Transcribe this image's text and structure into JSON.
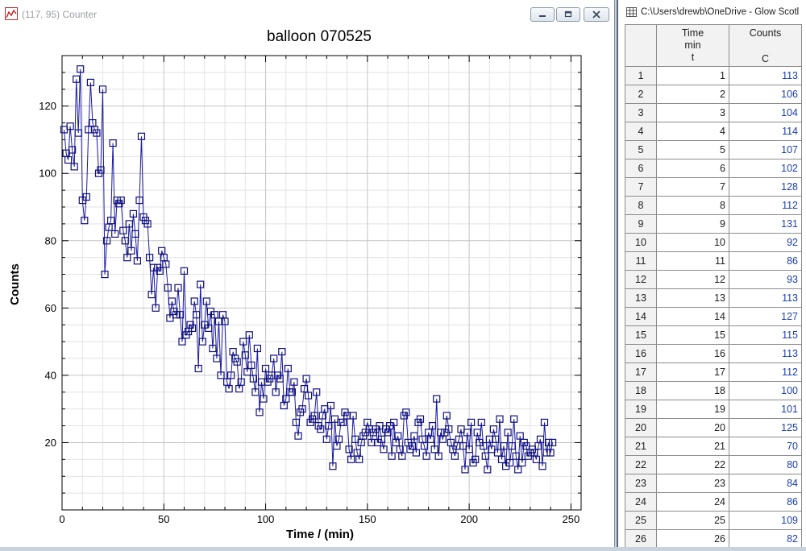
{
  "graph_window": {
    "title": "(117, 95) Counter",
    "buttons": {
      "minimize": "minimize-icon",
      "restore": "restore-icon",
      "close": "close-icon"
    }
  },
  "table_window": {
    "title": "C:\\Users\\drewb\\OneDrive - Glow Scotl",
    "columns": [
      {
        "line1": "Time",
        "line2": "min",
        "line3": "t"
      },
      {
        "line1": "Counts",
        "line2": "",
        "line3": "C"
      }
    ],
    "rows": [
      {
        "n": "1",
        "t": "1",
        "c": "113"
      },
      {
        "n": "2",
        "t": "2",
        "c": "106"
      },
      {
        "n": "3",
        "t": "3",
        "c": "104"
      },
      {
        "n": "4",
        "t": "4",
        "c": "114"
      },
      {
        "n": "5",
        "t": "5",
        "c": "107"
      },
      {
        "n": "6",
        "t": "6",
        "c": "102"
      },
      {
        "n": "7",
        "t": "7",
        "c": "128"
      },
      {
        "n": "8",
        "t": "8",
        "c": "112"
      },
      {
        "n": "9",
        "t": "9",
        "c": "131"
      },
      {
        "n": "10",
        "t": "10",
        "c": "92"
      },
      {
        "n": "11",
        "t": "11",
        "c": "86"
      },
      {
        "n": "12",
        "t": "12",
        "c": "93"
      },
      {
        "n": "13",
        "t": "13",
        "c": "113"
      },
      {
        "n": "14",
        "t": "14",
        "c": "127"
      },
      {
        "n": "15",
        "t": "15",
        "c": "115"
      },
      {
        "n": "16",
        "t": "16",
        "c": "113"
      },
      {
        "n": "17",
        "t": "17",
        "c": "112"
      },
      {
        "n": "18",
        "t": "18",
        "c": "100"
      },
      {
        "n": "19",
        "t": "19",
        "c": "101"
      },
      {
        "n": "20",
        "t": "20",
        "c": "125"
      },
      {
        "n": "21",
        "t": "21",
        "c": "70"
      },
      {
        "n": "22",
        "t": "22",
        "c": "80"
      },
      {
        "n": "23",
        "t": "23",
        "c": "84"
      },
      {
        "n": "24",
        "t": "24",
        "c": "86"
      },
      {
        "n": "25",
        "t": "25",
        "c": "109"
      },
      {
        "n": "26",
        "t": "26",
        "c": "82"
      }
    ]
  },
  "chart_data": {
    "type": "line",
    "title": "balloon 070525",
    "xlabel": "Time / (min)",
    "ylabel": "Counts",
    "xlim": [
      0,
      255
    ],
    "ylim": [
      0,
      135
    ],
    "xticks": [
      0,
      50,
      100,
      150,
      200,
      250
    ],
    "yticks": [
      20,
      40,
      60,
      80,
      100,
      120
    ],
    "grid": true,
    "marker": "square",
    "line_color": "#1a1aa0",
    "series": [
      {
        "x": [
          1,
          2,
          3,
          4,
          5,
          6,
          7,
          8,
          9,
          10,
          11,
          12,
          13,
          14,
          15,
          16,
          17,
          18,
          19,
          20,
          21,
          22,
          23,
          24,
          25,
          26,
          27,
          28,
          29,
          30,
          31,
          32,
          33,
          34,
          35,
          36,
          37,
          38,
          39,
          40,
          41,
          42,
          43,
          44,
          45,
          46,
          47,
          48,
          49,
          50,
          51,
          52,
          53,
          54,
          55,
          56,
          57,
          58,
          59,
          60,
          61,
          62,
          63,
          64,
          65,
          66,
          67,
          68,
          69,
          70,
          71,
          72,
          73,
          74,
          75,
          76,
          77,
          78,
          79,
          80,
          81,
          82,
          83,
          84,
          85,
          86,
          87,
          88,
          89,
          90,
          91,
          92,
          93,
          94,
          95,
          96,
          97,
          98,
          99,
          100,
          101,
          102,
          103,
          104,
          105,
          106,
          107,
          108,
          109,
          110,
          111,
          112,
          113,
          114,
          115,
          116,
          117,
          118,
          119,
          120,
          121,
          122,
          123,
          124,
          125,
          126,
          127,
          128,
          129,
          130,
          131,
          132,
          133,
          134,
          135,
          136,
          137,
          138,
          139,
          140,
          141,
          142,
          143,
          144,
          145,
          146,
          147,
          148,
          149,
          150,
          151,
          152,
          153,
          154,
          155,
          156,
          157,
          158,
          159,
          160,
          161,
          162,
          163,
          164,
          165,
          166,
          167,
          168,
          169,
          170,
          171,
          172,
          173,
          174,
          175,
          176,
          177,
          178,
          179,
          180,
          181,
          182,
          183,
          184,
          185,
          186,
          187,
          188,
          189,
          190,
          191,
          192,
          193,
          194,
          195,
          196,
          197,
          198,
          199,
          200,
          201,
          202,
          203,
          204,
          205,
          206,
          207,
          208,
          209,
          210,
          211,
          212,
          213,
          214,
          215,
          216,
          217,
          218,
          219,
          220,
          221,
          222,
          223,
          224,
          225,
          226,
          227,
          228,
          229,
          230,
          231,
          232,
          233,
          234,
          235,
          236,
          237,
          238,
          239,
          240,
          241
        ],
        "y": [
          113,
          106,
          104,
          114,
          107,
          102,
          128,
          112,
          131,
          92,
          86,
          93,
          113,
          127,
          115,
          113,
          112,
          100,
          101,
          125,
          70,
          80,
          84,
          86,
          109,
          82,
          92,
          91,
          92,
          83,
          80,
          75,
          85,
          77,
          88,
          82,
          74,
          92,
          111,
          87,
          86,
          85,
          75,
          64,
          72,
          60,
          72,
          71,
          77,
          75,
          73,
          66,
          57,
          62,
          59,
          58,
          66,
          58,
          50,
          71,
          52,
          53,
          55,
          54,
          62,
          58,
          42,
          67,
          50,
          55,
          62,
          54,
          59,
          48,
          58,
          45,
          56,
          40,
          58,
          56,
          38,
          36,
          40,
          47,
          45,
          44,
          36,
          38,
          50,
          46,
          41,
          52,
          43,
          39,
          35,
          48,
          29,
          38,
          33,
          42,
          38,
          39,
          40,
          45,
          35,
          40,
          39,
          47,
          31,
          33,
          42,
          35,
          35,
          38,
          26,
          22,
          29,
          30,
          36,
          39,
          34,
          26,
          27,
          28,
          35,
          25,
          24,
          28,
          30,
          21,
          25,
          31,
          13,
          27,
          19,
          21,
          26,
          26,
          29,
          28,
          18,
          15,
          28,
          21,
          17,
          15,
          20,
          22,
          23,
          26,
          24,
          20,
          23,
          24,
          20,
          25,
          21,
          18,
          24,
          23,
          25,
          16,
          26,
          20,
          22,
          18,
          16,
          28,
          29,
          20,
          18,
          19,
          22,
          17,
          26,
          27,
          21,
          19,
          16,
          23,
          21,
          25,
          18,
          33,
          16,
          23,
          21,
          23,
          28,
          24,
          20,
          18,
          16,
          19,
          21,
          24,
          19,
          12,
          23,
          18,
          26,
          14,
          15,
          23,
          20,
          26,
          19,
          16,
          12,
          21,
          18,
          24,
          21,
          17,
          27,
          15,
          19,
          13,
          23,
          14,
          19,
          27,
          16,
          12,
          22,
          14,
          20,
          19,
          16,
          17,
          18,
          17,
          15,
          19,
          21,
          13,
          26,
          17,
          20,
          17,
          20
        ]
      }
    ]
  }
}
